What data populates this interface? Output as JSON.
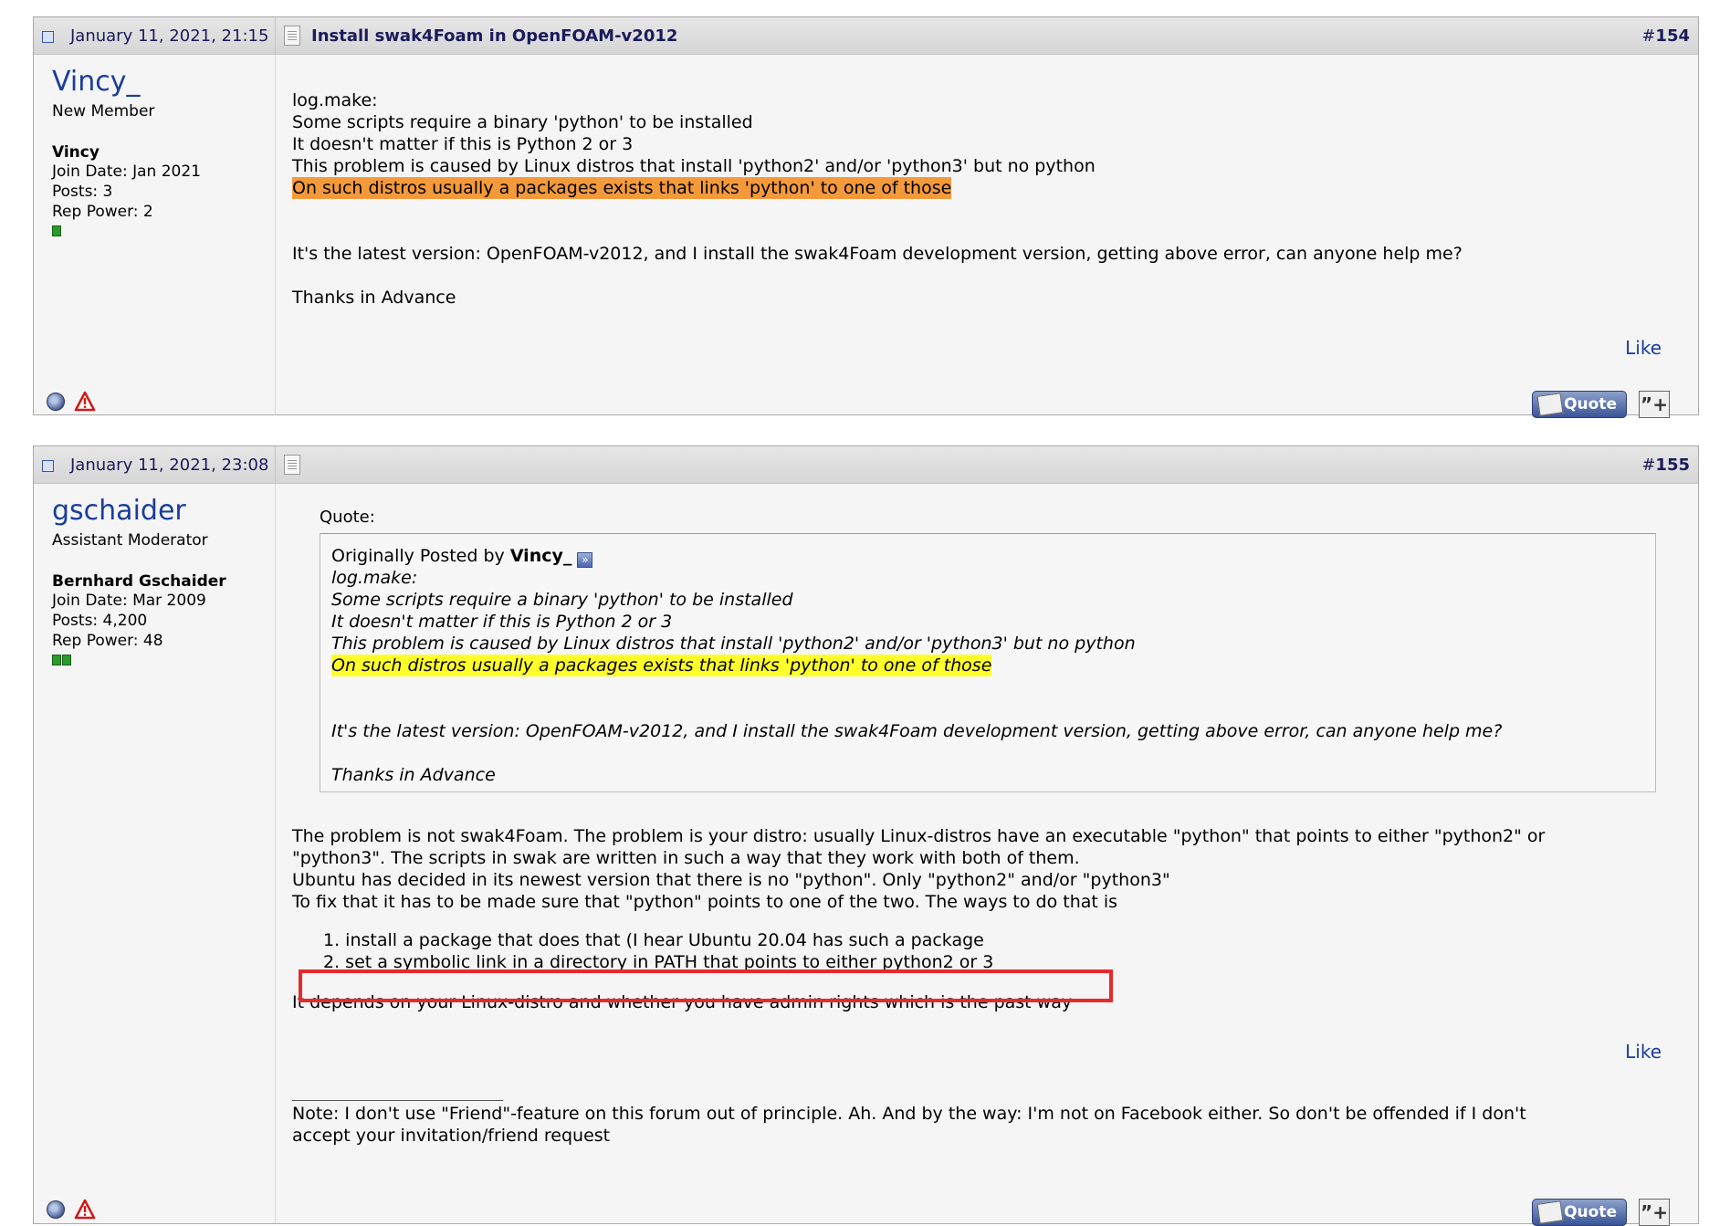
{
  "posts": [
    {
      "date": "January 11, 2021, 21:15",
      "title": "Install swak4Foam in OpenFOAM-v2012",
      "hash": "#",
      "number": "154",
      "username": "Vincy_",
      "user_title": "New Member",
      "real_name": "Vincy",
      "join_date": "Join Date: Jan 2021",
      "posts_count": "Posts: 3",
      "rep_power": "Rep Power: 2",
      "body_lines": [
        "log.make:",
        "Some scripts require a binary 'python' to be installed",
        "It doesn't matter if this is Python 2 or 3",
        "This problem is caused by Linux distros that install 'python2' and/or 'python3' but no python",
        "On such distros usually a packages exists that links 'python' to one of those",
        "It's the latest version: OpenFOAM-v2012, and I install the swak4Foam development version, getting above error, can anyone help me?",
        "Thanks in Advance"
      ],
      "like_label": "Like",
      "quote_label": "Quote",
      "multiquote_glyph": "”+"
    },
    {
      "date": "January 11, 2021, 23:08",
      "title": "",
      "hash": "#",
      "number": "155",
      "username": "gschaider",
      "user_title": "Assistant Moderator",
      "real_name": "Bernhard Gschaider",
      "join_date": "Join Date: Mar 2009",
      "posts_count": "Posts: 4,200",
      "rep_power": "Rep Power: 48",
      "quote": {
        "label": "Quote:",
        "originally_posted_by": "Originally Posted by ",
        "author": "Vincy_",
        "arrow_glyph": "»",
        "lines": [
          "log.make:",
          "Some scripts require a binary 'python' to be installed",
          "It doesn't matter if this is Python 2 or 3",
          "This problem is caused by Linux distros that install 'python2' and/or 'python3' but no python",
          "On such distros usually a packages exists that links 'python' to one of those",
          "It's the latest version: OpenFOAM-v2012, and I install the swak4Foam development version, getting above error, can anyone help me?",
          "Thanks in Advance"
        ]
      },
      "body_lines": [
        "The problem is not swak4Foam. The problem is your distro: usually Linux-distros have an executable \"python\" that points to either \"python2\" or",
        "\"python3\". The scripts in swak are written in such a way that they work with both of them.",
        "Ubuntu has decided in its newest version that there is no \"python\". Only \"python2\" and/or \"python3\"",
        "To fix that it has to be made sure that \"python\" points to one of the two. The ways to do that is"
      ],
      "list_items": [
        "1. install a package that does that (I hear Ubuntu 20.04 has such a package",
        "2. set a symbolic link in a directory in PATH that points to either python2 or 3"
      ],
      "closing_line": "It depends on your Linux-distro and whether you have admin rights which is the past way",
      "signature_lines": [
        "Note: I don't use \"Friend\"-feature on this forum out of principle. Ah. And by the way: I'm not on Facebook either. So don't be offended if I don't",
        "accept your invitation/friend request"
      ],
      "like_label": "Like",
      "quote_label": "Quote",
      "multiquote_glyph": "”+"
    }
  ],
  "colors": {
    "highlight_orange": "#f59a3a",
    "highlight_yellow": "#ffff2a",
    "annotation_red": "#e82a2a",
    "link_blue": "#1a3d9c"
  },
  "icons": {
    "post_icon": "post-icon",
    "doc_icon": "document-icon",
    "status_icon": "offline-status-icon",
    "report_icon": "report-warning-icon"
  }
}
